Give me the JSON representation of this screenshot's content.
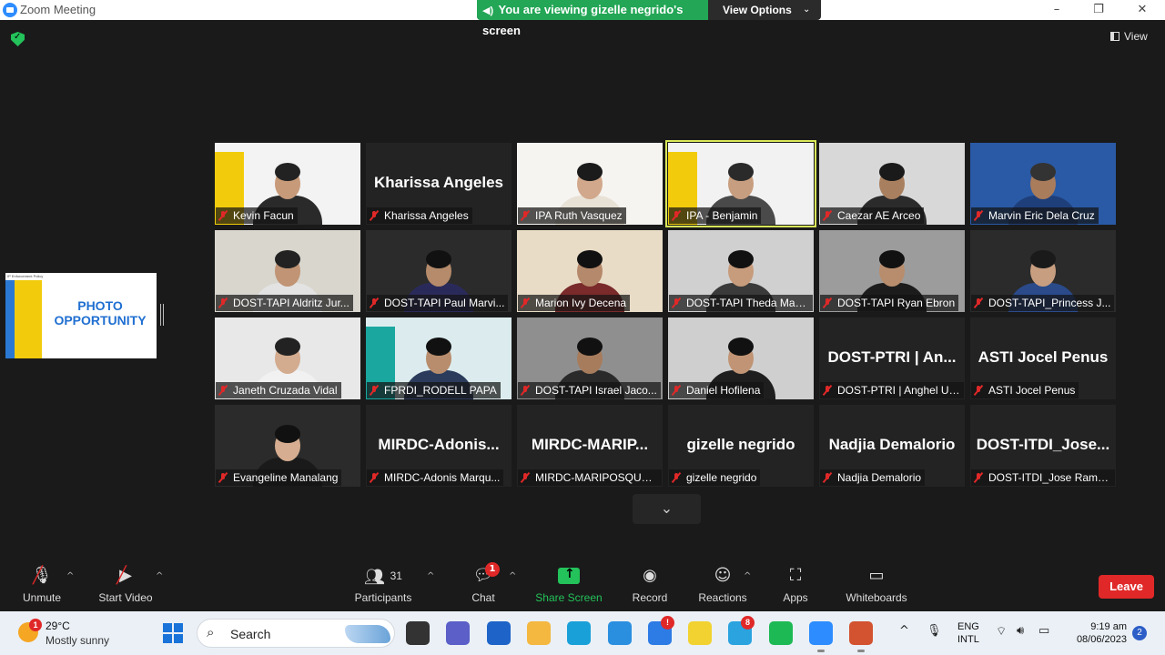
{
  "window": {
    "title": "Zoom Meeting",
    "controls": [
      "minimize-icon",
      "restore-icon",
      "close-icon"
    ]
  },
  "share_banner": {
    "status_text": "You are viewing gizelle negrido's screen",
    "view_options_label": "View Options"
  },
  "top_right": {
    "view_label": "View"
  },
  "shared_screen": {
    "slide_header": "IP Enforcement Policy",
    "slide_line1": "PHOTO",
    "slide_line2": "OPPORTUNITY"
  },
  "participants": [
    {
      "name": "Kevin Facun",
      "tile": "video",
      "bg": "#f3f3f3",
      "accent": "#f2cc0c",
      "skin": "#c79a7a",
      "shirt": "#2a2a2a",
      "hair": "#222"
    },
    {
      "name": "Kharissa Angeles",
      "display_name": "Kharissa Angeles",
      "tile": "name"
    },
    {
      "name": "IPA Ruth Vasquez",
      "tile": "video",
      "bg": "#f6f4f0",
      "skin": "#d1a88c",
      "shirt": "#e8e1d6",
      "hair": "#1b1b1b"
    },
    {
      "name": "IPA - Benjamin",
      "tile": "video",
      "active": true,
      "bg": "#f2f2f2",
      "accent": "#f2cc0c",
      "skin": "#c89e80",
      "shirt": "#4a4a4a",
      "hair": "#2a2a2a"
    },
    {
      "name": "Caezar AE Arceo",
      "tile": "video",
      "bg": "#d8d8d8",
      "skin": "#a9805f",
      "shirt": "#2b2b2b",
      "hair": "#1a1a1a"
    },
    {
      "name": "Marvin Eric Dela Cruz",
      "tile": "video",
      "bg": "#2a5aa6",
      "skin": "#a97c5c",
      "shirt": "#1f3f7a",
      "hair": "#333"
    },
    {
      "name": "DOST-TAPI Aldritz Jur...",
      "tile": "video",
      "bg": "#d9d6ce",
      "skin": "#c09474",
      "shirt": "#e3e3e3",
      "hair": "#222"
    },
    {
      "name": "DOST-TAPI Paul Marvi...",
      "tile": "video",
      "bg": "#2b2b2b",
      "skin": "#b58b6b",
      "shirt": "#2a2a5a",
      "hair": "#111"
    },
    {
      "name": "Marion Ivy Decena",
      "tile": "video",
      "bg": "#e9dcc6",
      "skin": "#b5896b",
      "shirt": "#7a2a2a",
      "hair": "#111"
    },
    {
      "name": "DOST-TAPI Theda Mae...",
      "tile": "video",
      "bg": "#d0d0d0",
      "skin": "#c79c7c",
      "shirt": "#3a3a3a",
      "hair": "#111"
    },
    {
      "name": "DOST-TAPI Ryan Ebron",
      "tile": "video",
      "bg": "#9c9c9c",
      "skin": "#b88d6d",
      "shirt": "#1c1c1c",
      "hair": "#111"
    },
    {
      "name": "DOST-TAPI_Princess J...",
      "tile": "video",
      "bg": "#2b2b2b",
      "skin": "#c89e80",
      "shirt": "#2a4a8a",
      "hair": "#1a1a1a"
    },
    {
      "name": "Janeth Cruzada Vidal",
      "tile": "video",
      "bg": "#e8e8e8",
      "skin": "#d3ab8f",
      "shirt": "#f1f1f1",
      "hair": "#222"
    },
    {
      "name": "FPRDI_RODELL PAPA",
      "tile": "video",
      "bg": "#dcecee",
      "accent": "#1aa7a0",
      "skin": "#b88d6d",
      "shirt": "#2b3b5b",
      "hair": "#111"
    },
    {
      "name": "DOST-TAPI Israel Jaco...",
      "tile": "video",
      "bg": "#8f8f8f",
      "skin": "#a67c5d",
      "shirt": "#2a2a2a",
      "hair": "#111"
    },
    {
      "name": "Daniel Hofilena",
      "tile": "video",
      "bg": "#cfcfcf",
      "skin": "#c09474",
      "shirt": "#1e1e1e",
      "hair": "#111"
    },
    {
      "name": "DOST-PTRI | Anghel Ul...",
      "display_name": "DOST-PTRI | An...",
      "tile": "name"
    },
    {
      "name": "ASTI Jocel Penus",
      "display_name": "ASTI Jocel Penus",
      "tile": "name"
    },
    {
      "name": "Evangeline Manalang",
      "tile": "video",
      "bg": "#2b2b2b",
      "skin": "#d6ad90",
      "shirt": "#1a1a1a",
      "hair": "#111"
    },
    {
      "name": "MIRDC-Adonis Marqu...",
      "display_name": "MIRDC-Adonis...",
      "tile": "name"
    },
    {
      "name": "MIRDC-MARIPOSQUE,...",
      "display_name": "MIRDC-MARIP...",
      "tile": "name"
    },
    {
      "name": "gizelle negrido",
      "display_name": "gizelle negrido",
      "tile": "name"
    },
    {
      "name": "Nadjia Demalorio",
      "display_name": "Nadjia Demalorio",
      "tile": "name"
    },
    {
      "name": "DOST-ITDI_Jose Ramo...",
      "display_name": "DOST-ITDI_Jose...",
      "tile": "name"
    }
  ],
  "toolbar": {
    "unmute_label": "Unmute",
    "start_video_label": "Start Video",
    "participants_label": "Participants",
    "participants_count": "31",
    "chat_label": "Chat",
    "chat_badge": "1",
    "share_screen_label": "Share Screen",
    "record_label": "Record",
    "reactions_label": "Reactions",
    "apps_label": "Apps",
    "whiteboards_label": "Whiteboards",
    "leave_label": "Leave",
    "share_color": "#23c25a",
    "leave_color": "#e02828"
  },
  "taskbar": {
    "weather_badge": "1",
    "temperature": "29°C",
    "condition": "Mostly sunny",
    "search_label": "Search",
    "apps": [
      {
        "icon": "file-explorer-icon",
        "color": "#333333"
      },
      {
        "icon": "teams-icon",
        "color": "#5b5fc7"
      },
      {
        "icon": "microsoft-store-icon",
        "color": "#1e64c8"
      },
      {
        "icon": "folder-icon",
        "color": "#f4b740"
      },
      {
        "icon": "edge-icon",
        "color": "#1aa0d8"
      },
      {
        "icon": "hp-icon",
        "color": "#2b8fe0"
      },
      {
        "icon": "help-icon",
        "color": "#2d7be5",
        "badge": "!"
      },
      {
        "icon": "sticky-notes-icon",
        "color": "#f2d230"
      },
      {
        "icon": "telegram-icon",
        "color": "#2aa3df",
        "badge": "8"
      },
      {
        "icon": "spotify-icon",
        "color": "#1db954"
      },
      {
        "icon": "zoom-icon",
        "color": "#2d8cff"
      },
      {
        "icon": "powerpoint-icon",
        "color": "#d35230"
      }
    ],
    "lang_line1": "ENG",
    "lang_line2": "INTL",
    "time": "9:19 am",
    "date": "08/06/2023",
    "notification_count": "2"
  }
}
